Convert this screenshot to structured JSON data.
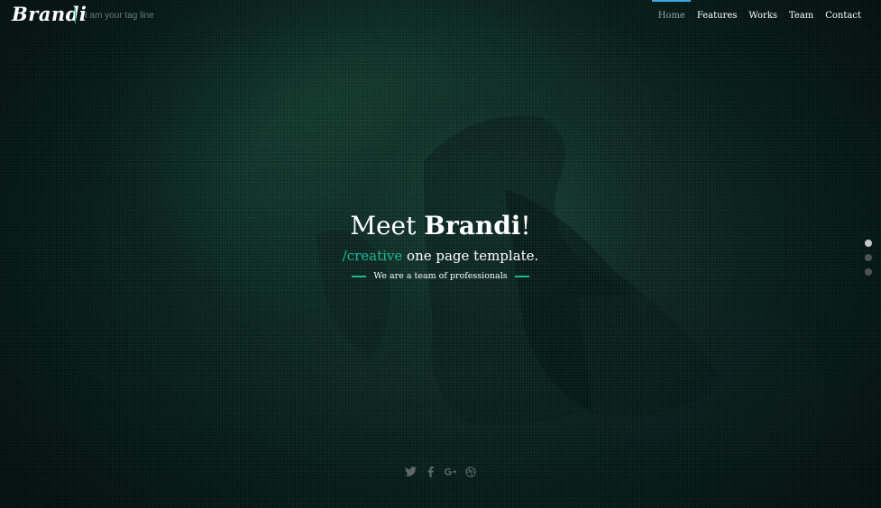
{
  "header": {
    "logo": "Brandi",
    "tagline": "I am your tag line"
  },
  "nav": {
    "items": [
      {
        "label": "Home",
        "active": true
      },
      {
        "label": "Features",
        "active": false
      },
      {
        "label": "Works",
        "active": false
      },
      {
        "label": "Team",
        "active": false
      },
      {
        "label": "Contact",
        "active": false
      }
    ]
  },
  "hero": {
    "headline_prefix": "Meet ",
    "headline_brand": "Brandi",
    "headline_suffix": "!",
    "subline_accent": "/creative",
    "subline_rest": " one page template.",
    "tag": "We are a team of professionals"
  },
  "slider": {
    "slide_count": 3,
    "active_slide": 1
  },
  "social": {
    "icons": [
      "twitter-icon",
      "facebook-icon",
      "google-plus-icon",
      "dribbble-icon"
    ]
  },
  "colors": {
    "accent": "#1fb89a",
    "nav_active_bar": "#39a6df",
    "background": "#0a201d"
  }
}
